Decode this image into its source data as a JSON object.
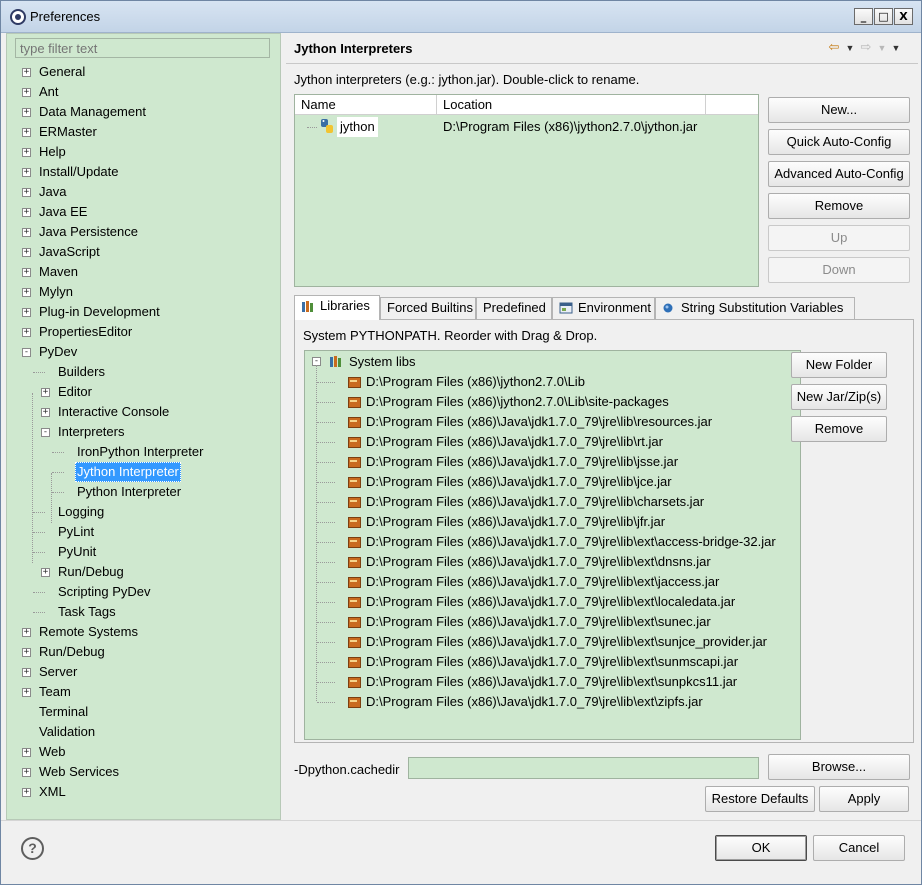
{
  "window": {
    "title": "Preferences",
    "min_glyph": "_",
    "max_glyph": "□",
    "close_glyph": "X"
  },
  "filter": {
    "placeholder": "type filter text"
  },
  "tree": [
    {
      "label": "General",
      "level": 0,
      "expander": "+"
    },
    {
      "label": "Ant",
      "level": 0,
      "expander": "+"
    },
    {
      "label": "Data Management",
      "level": 0,
      "expander": "+"
    },
    {
      "label": "ERMaster",
      "level": 0,
      "expander": "+"
    },
    {
      "label": "Help",
      "level": 0,
      "expander": "+"
    },
    {
      "label": "Install/Update",
      "level": 0,
      "expander": "+"
    },
    {
      "label": "Java",
      "level": 0,
      "expander": "+"
    },
    {
      "label": "Java EE",
      "level": 0,
      "expander": "+"
    },
    {
      "label": "Java Persistence",
      "level": 0,
      "expander": "+"
    },
    {
      "label": "JavaScript",
      "level": 0,
      "expander": "+"
    },
    {
      "label": "Maven",
      "level": 0,
      "expander": "+"
    },
    {
      "label": "Mylyn",
      "level": 0,
      "expander": "+"
    },
    {
      "label": "Plug-in Development",
      "level": 0,
      "expander": "+"
    },
    {
      "label": "PropertiesEditor",
      "level": 0,
      "expander": "+"
    },
    {
      "label": "PyDev",
      "level": 0,
      "expander": "-"
    },
    {
      "label": "Builders",
      "level": 1,
      "expander": ""
    },
    {
      "label": "Editor",
      "level": 1,
      "expander": "+"
    },
    {
      "label": "Interactive Console",
      "level": 1,
      "expander": "+"
    },
    {
      "label": "Interpreters",
      "level": 1,
      "expander": "-"
    },
    {
      "label": "IronPython Interpreter",
      "level": 2,
      "expander": ""
    },
    {
      "label": "Jython Interpreter",
      "level": 2,
      "expander": "",
      "selected": true
    },
    {
      "label": "Python Interpreter",
      "level": 2,
      "expander": ""
    },
    {
      "label": "Logging",
      "level": 1,
      "expander": ""
    },
    {
      "label": "PyLint",
      "level": 1,
      "expander": ""
    },
    {
      "label": "PyUnit",
      "level": 1,
      "expander": ""
    },
    {
      "label": "Run/Debug",
      "level": 1,
      "expander": "+"
    },
    {
      "label": "Scripting PyDev",
      "level": 1,
      "expander": ""
    },
    {
      "label": "Task Tags",
      "level": 1,
      "expander": ""
    },
    {
      "label": "Remote Systems",
      "level": 0,
      "expander": "+"
    },
    {
      "label": "Run/Debug",
      "level": 0,
      "expander": "+"
    },
    {
      "label": "Server",
      "level": 0,
      "expander": "+"
    },
    {
      "label": "Team",
      "level": 0,
      "expander": "+"
    },
    {
      "label": "Terminal",
      "level": 0,
      "expander": ""
    },
    {
      "label": "Validation",
      "level": 0,
      "expander": ""
    },
    {
      "label": "Web",
      "level": 0,
      "expander": "+"
    },
    {
      "label": "Web Services",
      "level": 0,
      "expander": "+"
    },
    {
      "label": "XML",
      "level": 0,
      "expander": "+"
    }
  ],
  "page": {
    "title": "Jython Interpreters",
    "description": "Jython interpreters (e.g.: jython.jar).   Double-click to rename."
  },
  "interpreters": {
    "columns": [
      "Name",
      "Location"
    ],
    "rows": [
      {
        "name": "jython",
        "location": "D:\\Program Files (x86)\\jython2.7.0\\jython.jar"
      }
    ]
  },
  "interpreter_buttons": {
    "new": "New...",
    "quick": "Quick Auto-Config",
    "advanced": "Advanced Auto-Config",
    "remove": "Remove",
    "up": "Up",
    "down": "Down"
  },
  "tabs": [
    {
      "label": "Libraries",
      "active": true,
      "icon": "books-icon"
    },
    {
      "label": "Forced Builtins",
      "active": false
    },
    {
      "label": "Predefined",
      "active": false
    },
    {
      "label": "Environment",
      "active": false,
      "icon": "environment-icon"
    },
    {
      "label": "String Substitution Variables",
      "active": false,
      "icon": "variable-dot-icon"
    }
  ],
  "libraries": {
    "description": "System PYTHONPATH.   Reorder with Drag & Drop.",
    "root": "System libs",
    "items": [
      "D:\\Program Files (x86)\\jython2.7.0\\Lib",
      "D:\\Program Files (x86)\\jython2.7.0\\Lib\\site-packages",
      "D:\\Program Files (x86)\\Java\\jdk1.7.0_79\\jre\\lib\\resources.jar",
      "D:\\Program Files (x86)\\Java\\jdk1.7.0_79\\jre\\lib\\rt.jar",
      "D:\\Program Files (x86)\\Java\\jdk1.7.0_79\\jre\\lib\\jsse.jar",
      "D:\\Program Files (x86)\\Java\\jdk1.7.0_79\\jre\\lib\\jce.jar",
      "D:\\Program Files (x86)\\Java\\jdk1.7.0_79\\jre\\lib\\charsets.jar",
      "D:\\Program Files (x86)\\Java\\jdk1.7.0_79\\jre\\lib\\jfr.jar",
      "D:\\Program Files (x86)\\Java\\jdk1.7.0_79\\jre\\lib\\ext\\access-bridge-32.jar",
      "D:\\Program Files (x86)\\Java\\jdk1.7.0_79\\jre\\lib\\ext\\dnsns.jar",
      "D:\\Program Files (x86)\\Java\\jdk1.7.0_79\\jre\\lib\\ext\\jaccess.jar",
      "D:\\Program Files (x86)\\Java\\jdk1.7.0_79\\jre\\lib\\ext\\localedata.jar",
      "D:\\Program Files (x86)\\Java\\jdk1.7.0_79\\jre\\lib\\ext\\sunec.jar",
      "D:\\Program Files (x86)\\Java\\jdk1.7.0_79\\jre\\lib\\ext\\sunjce_provider.jar",
      "D:\\Program Files (x86)\\Java\\jdk1.7.0_79\\jre\\lib\\ext\\sunmscapi.jar",
      "D:\\Program Files (x86)\\Java\\jdk1.7.0_79\\jre\\lib\\ext\\sunpkcs11.jar",
      "D:\\Program Files (x86)\\Java\\jdk1.7.0_79\\jre\\lib\\ext\\zipfs.jar"
    ]
  },
  "library_buttons": {
    "new_folder": "New Folder",
    "new_jar": "New Jar/Zip(s)",
    "remove": "Remove"
  },
  "cachedir": {
    "label": "-Dpython.cachedir",
    "value": ""
  },
  "page_buttons": {
    "browse": "Browse...",
    "restore": "Restore Defaults",
    "apply": "Apply"
  },
  "dialog_buttons": {
    "ok": "OK",
    "cancel": "Cancel",
    "help_glyph": "?"
  },
  "nav_glyphs": {
    "back": "⇦",
    "back_menu": "▼",
    "forward": "⇨",
    "forward_menu": "▼",
    "view_menu": "▼"
  },
  "colors": {
    "tree_bg": "#cfe8cf",
    "selection": "#3399ff"
  }
}
